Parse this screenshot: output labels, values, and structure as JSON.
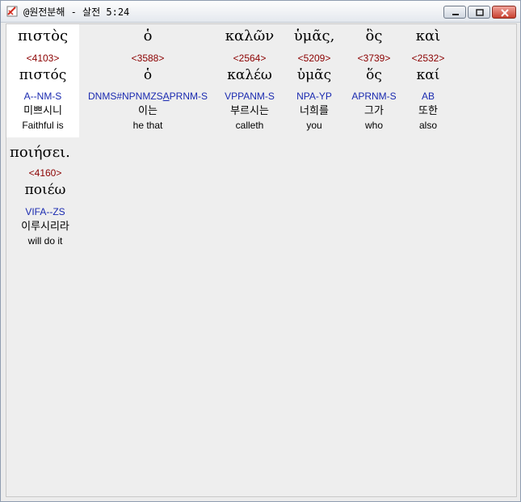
{
  "window": {
    "title": "@원전분해 - 살전 5:24"
  },
  "words": [
    {
      "greek": "πιστὸς",
      "strong": "<4103>",
      "lemma": "πιστός",
      "morph_a": "A--NM-S",
      "morph_b": "",
      "morph_c": "",
      "korean": "미쁘시니",
      "english": "Faithful is"
    },
    {
      "greek": "ὁ",
      "strong": "<3588>",
      "lemma": "ὁ",
      "morph_a": "DNMS#NPNMZS",
      "morph_b": "A",
      "morph_c": "PRNM-S",
      "korean": "이는",
      "english": "he that"
    },
    {
      "greek": "καλῶν",
      "strong": "<2564>",
      "lemma": "καλέω",
      "morph_a": "VPPANM-S",
      "morph_b": "",
      "morph_c": "",
      "korean": "부르시는",
      "english": "calleth"
    },
    {
      "greek": "ὑμᾶς,",
      "strong": "<5209>",
      "lemma": "ὑμᾶς",
      "morph_a": "NPA-YP",
      "morph_b": "",
      "morph_c": "",
      "korean": "너희를",
      "english": "you"
    },
    {
      "greek": "ὃς",
      "strong": "<3739>",
      "lemma": "ὅς",
      "morph_a": "APRNM-S",
      "morph_b": "",
      "morph_c": "",
      "korean": "그가",
      "english": "who"
    },
    {
      "greek": "καὶ",
      "strong": "<2532>",
      "lemma": "καί",
      "morph_a": "AB",
      "morph_b": "",
      "morph_c": "",
      "korean": "또한",
      "english": "also"
    },
    {
      "greek": "ποιήσει.",
      "strong": "<4160>",
      "lemma": "ποιέω",
      "morph_a": "VIFA--ZS",
      "morph_b": "",
      "morph_c": "",
      "korean": "이루시리라",
      "english": "will do it"
    }
  ]
}
